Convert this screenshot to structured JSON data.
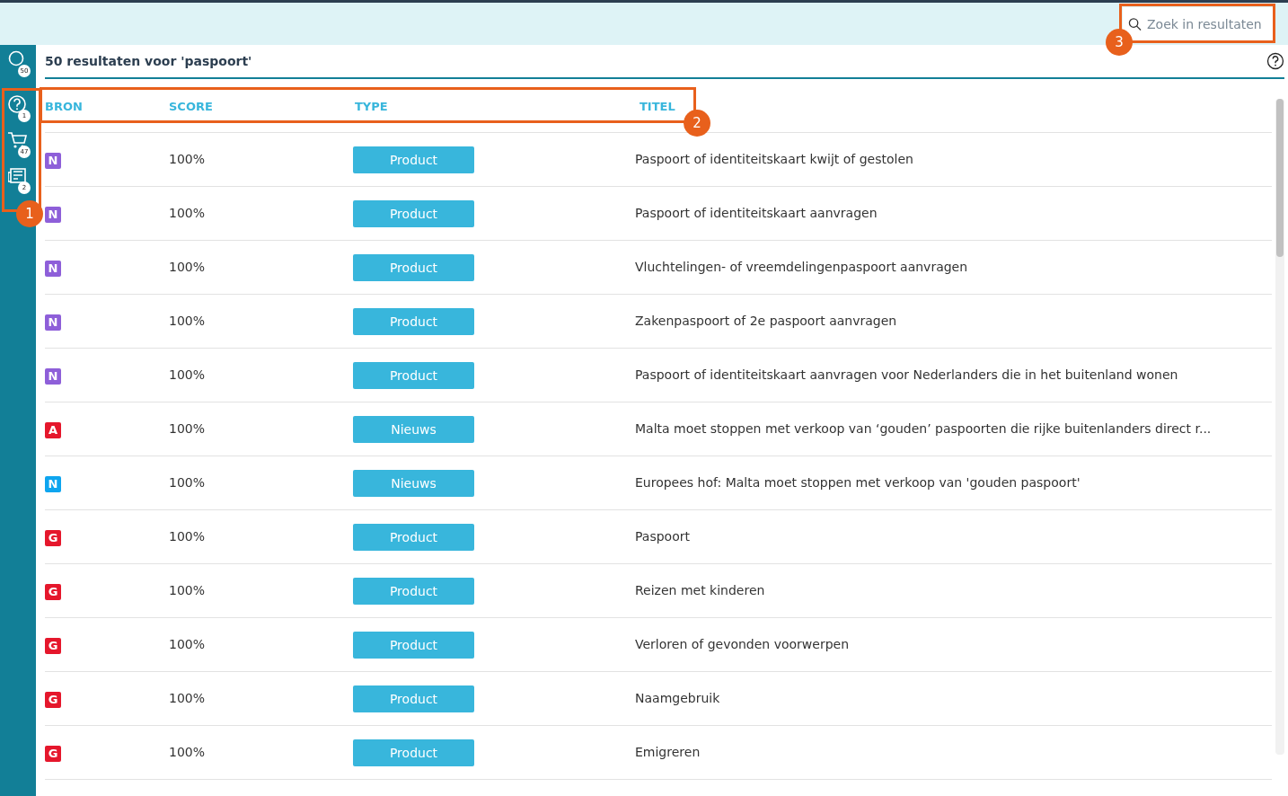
{
  "search": {
    "placeholder": "Zoek in resultaten"
  },
  "sidebar": {
    "items": [
      {
        "kind": "search",
        "count": "50"
      },
      {
        "kind": "help",
        "count": "1"
      },
      {
        "kind": "cart",
        "count": "47"
      },
      {
        "kind": "news",
        "count": "2"
      }
    ]
  },
  "results": {
    "title": "50 resultaten voor 'paspoort'",
    "columns": [
      "BRON",
      "SCORE",
      "TYPE",
      "TITEL"
    ],
    "rows": [
      {
        "source": "N",
        "color": "#8e5fd9",
        "score": "100%",
        "type": "Product",
        "title": "Paspoort of identiteitskaart kwijt of gestolen"
      },
      {
        "source": "N",
        "color": "#8e5fd9",
        "score": "100%",
        "type": "Product",
        "title": "Paspoort of identiteitskaart aanvragen"
      },
      {
        "source": "N",
        "color": "#8e5fd9",
        "score": "100%",
        "type": "Product",
        "title": "Vluchtelingen- of vreemdelingenpaspoort aanvragen"
      },
      {
        "source": "N",
        "color": "#8e5fd9",
        "score": "100%",
        "type": "Product",
        "title": "Zakenpaspoort of 2e paspoort aanvragen"
      },
      {
        "source": "N",
        "color": "#8e5fd9",
        "score": "100%",
        "type": "Product",
        "title": "Paspoort of identiteitskaart aanvragen voor Nederlanders die in het buitenland wonen"
      },
      {
        "source": "A",
        "color": "#e5172c",
        "score": "100%",
        "type": "Nieuws",
        "title": "Malta moet stoppen met verkoop van ‘gouden’ paspoorten die rijke buitenlanders direct r..."
      },
      {
        "source": "N",
        "color": "#0ea5ef",
        "score": "100%",
        "type": "Nieuws",
        "title": "Europees hof: Malta moet stoppen met verkoop van 'gouden paspoort'"
      },
      {
        "source": "G",
        "color": "#e5172c",
        "score": "100%",
        "type": "Product",
        "title": "Paspoort"
      },
      {
        "source": "G",
        "color": "#e5172c",
        "score": "100%",
        "type": "Product",
        "title": "Reizen met kinderen"
      },
      {
        "source": "G",
        "color": "#e5172c",
        "score": "100%",
        "type": "Product",
        "title": "Verloren of gevonden voorwerpen"
      },
      {
        "source": "G",
        "color": "#e5172c",
        "score": "100%",
        "type": "Product",
        "title": "Naamgebruik"
      },
      {
        "source": "G",
        "color": "#e5172c",
        "score": "100%",
        "type": "Product",
        "title": "Emigreren"
      }
    ]
  },
  "callouts": [
    {
      "number": "1"
    },
    {
      "number": "2"
    },
    {
      "number": "3"
    }
  ]
}
